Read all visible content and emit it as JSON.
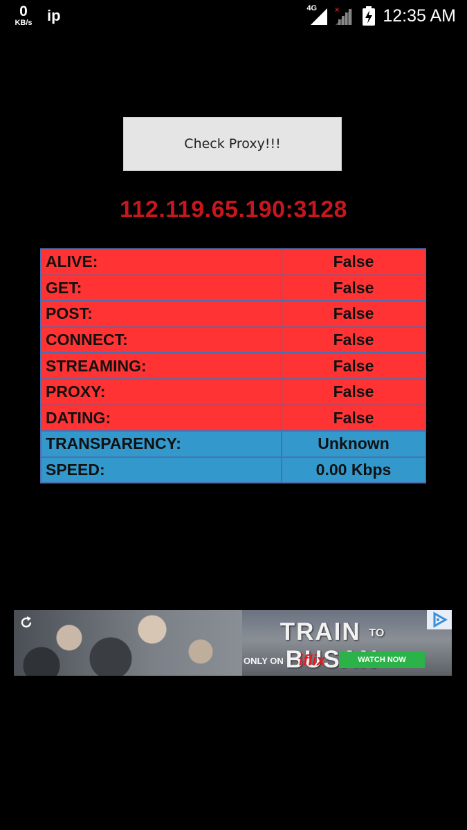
{
  "status_bar": {
    "net_speed_value": "0",
    "net_speed_unit": "KB/s",
    "app_label": "ip",
    "network_type": "4G",
    "time": "12:35 AM"
  },
  "check_button": {
    "label": "Check Proxy!!!"
  },
  "proxy": {
    "address": "112.119.65.190:3128"
  },
  "results": [
    {
      "label": "ALIVE:",
      "value": "False",
      "color": "#ff3333"
    },
    {
      "label": "GET:",
      "value": "False",
      "color": "#ff3333"
    },
    {
      "label": "POST:",
      "value": "False",
      "color": "#ff3333"
    },
    {
      "label": "CONNECT:",
      "value": "False",
      "color": "#ff3333"
    },
    {
      "label": "STREAMING:",
      "value": "False",
      "color": "#ff3333"
    },
    {
      "label": "PROXY:",
      "value": "False",
      "color": "#ff3333"
    },
    {
      "label": "DATING:",
      "value": "False",
      "color": "#ff3333"
    },
    {
      "label": "TRANSPARENCY:",
      "value": "Unknown",
      "color": "#3399cc"
    },
    {
      "label": "SPEED:",
      "value": "0.00 Kbps",
      "color": "#3399cc"
    }
  ],
  "ad": {
    "title_part1": "TRAIN",
    "title_small": "TO",
    "title_part2": "BUSAN",
    "only_on": "ONLY ON",
    "brand": "iflix",
    "cta": "WATCH NOW"
  },
  "colors": {
    "background": "#000000",
    "proxy_address": "#c8161e",
    "status_false": "#ff3333",
    "status_info": "#3399cc",
    "table_border": "#4d6fb0",
    "button_bg": "#e5e5e5"
  },
  "icons": [
    "signal-icon",
    "no-signal-icon",
    "battery-charging-icon",
    "refresh-icon",
    "ad-choices-icon"
  ]
}
